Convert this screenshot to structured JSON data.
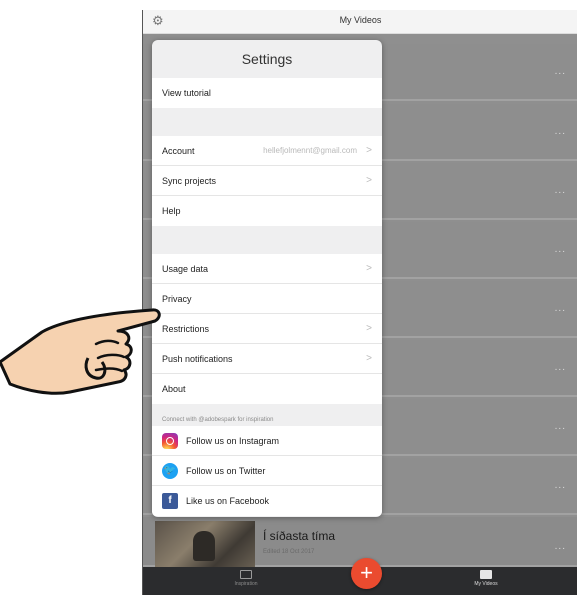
{
  "header": {
    "title": "My Videos"
  },
  "settings": {
    "title": "Settings",
    "view_tutorial": "View tutorial",
    "account_label": "Account",
    "account_email": "hellefjolmennt@gmail.com",
    "sync_projects": "Sync projects",
    "help": "Help",
    "usage_data": "Usage data",
    "privacy": "Privacy",
    "restrictions": "Restrictions",
    "push_notifications": "Push notifications",
    "about": "About",
    "connect_label": "Connect with @adobespark for inspiration",
    "instagram": "Follow us on Instagram",
    "twitter": "Follow us on Twitter",
    "facebook": "Like us on Facebook"
  },
  "video": {
    "title": "Í síðasta tíma",
    "edited": "Edited 18 Oct 2017"
  },
  "more_label": "...",
  "tabbar": {
    "inspiration": "Inspiration",
    "my_videos": "My Videos",
    "add": "+"
  },
  "colors": {
    "fab": "#ea4b2f",
    "twitter": "#1da1f2",
    "facebook": "#3b5998"
  }
}
